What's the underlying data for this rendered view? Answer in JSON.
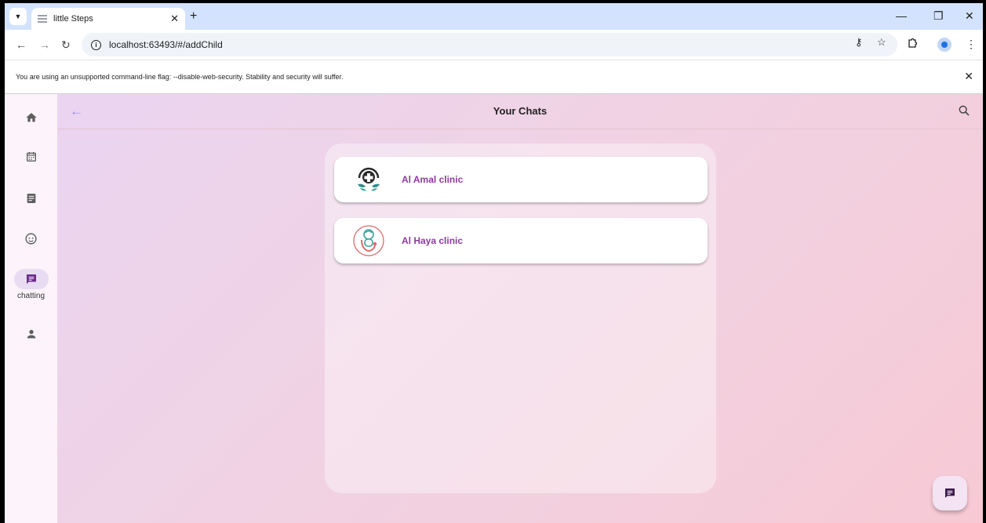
{
  "browser": {
    "tab_title": "little Steps",
    "url": "localhost:63493/#/addChild",
    "infobar_text": "You are using an unsupported command-line flag: --disable-web-security. Stability and security will suffer."
  },
  "app": {
    "title": "Your Chats",
    "nav": [
      {
        "icon": "home-icon",
        "label": ""
      },
      {
        "icon": "calendar-icon",
        "label": ""
      },
      {
        "icon": "article-icon",
        "label": ""
      },
      {
        "icon": "face-icon",
        "label": ""
      },
      {
        "icon": "chat-icon",
        "label": "chatting",
        "active": true
      },
      {
        "icon": "person-icon",
        "label": ""
      }
    ],
    "chats": [
      {
        "name": "Al Amal clinic",
        "avatar": "medical-cross-logo"
      },
      {
        "name": "Al Haya clinic",
        "avatar": "baby-stethoscope-logo"
      }
    ]
  },
  "colors": {
    "accent": "#8e3aa0",
    "rail_active": "#e8dcf2",
    "nav_icon": "#5f5f5f",
    "back_arrow": "#9b8cf0"
  }
}
